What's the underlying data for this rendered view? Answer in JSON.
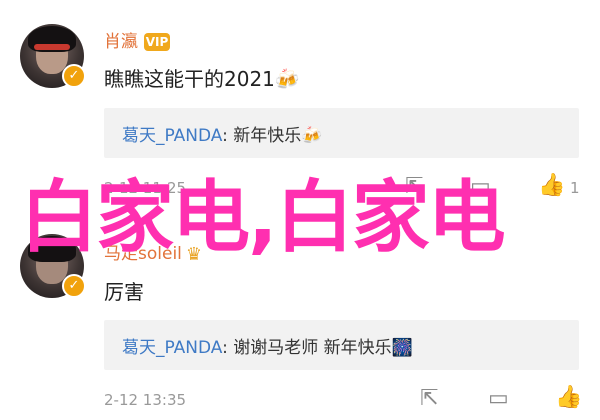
{
  "comments": [
    {
      "username": "肖瀛",
      "text": "瞧瞧这能干的2021🍻",
      "reply": {
        "name": "葛天_PANDA",
        "sep": ": ",
        "text": "新年快乐🍻"
      },
      "time": "2-12 11:25",
      "likes": "1"
    },
    {
      "username": "马走soleil",
      "text": "厉害",
      "reply": {
        "name": "葛天_PANDA",
        "sep": ": ",
        "text": "谢谢马老师 新年快乐🎆"
      },
      "time": "2-12 13:35",
      "likes": ""
    }
  ],
  "overlay": {
    "text": "白家电,白家电"
  },
  "icons": {
    "verified": "verified-badge-icon",
    "share": "share-icon",
    "comment": "comment-icon",
    "like": "thumbs-up-icon"
  },
  "colors": {
    "username": "#e2733a",
    "reply_name": "#3f7ac5",
    "verified": "#f1a20c",
    "overlay": "#ff2fb0"
  }
}
